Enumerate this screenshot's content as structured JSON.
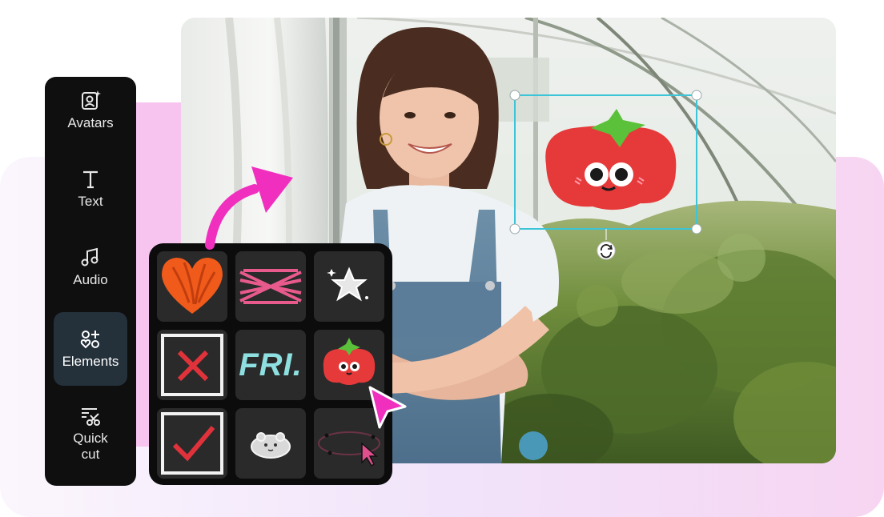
{
  "sidebar": {
    "items": [
      {
        "label": "Avatars",
        "icon": "avatar-icon"
      },
      {
        "label": "Text",
        "icon": "text-icon"
      },
      {
        "label": "Audio",
        "icon": "music-note-icon"
      },
      {
        "label": "Elements",
        "icon": "elements-icon",
        "active": true
      },
      {
        "label": "Quick\ncut",
        "icon": "scissors-icon"
      }
    ]
  },
  "elements_panel": {
    "tiles": [
      {
        "name": "heart-sticker"
      },
      {
        "name": "cross-lines-sticker"
      },
      {
        "name": "sparkle-star-sticker"
      },
      {
        "name": "x-box-sticker"
      },
      {
        "name": "fri-text-sticker",
        "text": "FRI."
      },
      {
        "name": "tomato-sticker",
        "selected": true
      },
      {
        "name": "checkmark-box-sticker"
      },
      {
        "name": "bear-cloud-sticker"
      },
      {
        "name": "orbit-cursor-sticker"
      }
    ]
  },
  "colors": {
    "accent_pink": "#f02fbf",
    "selection_cyan": "#3cc4d8",
    "sidebar_bg": "#0f0f10",
    "panel_bg": "#0c0c0d",
    "active_item_bg": "#24303a"
  }
}
